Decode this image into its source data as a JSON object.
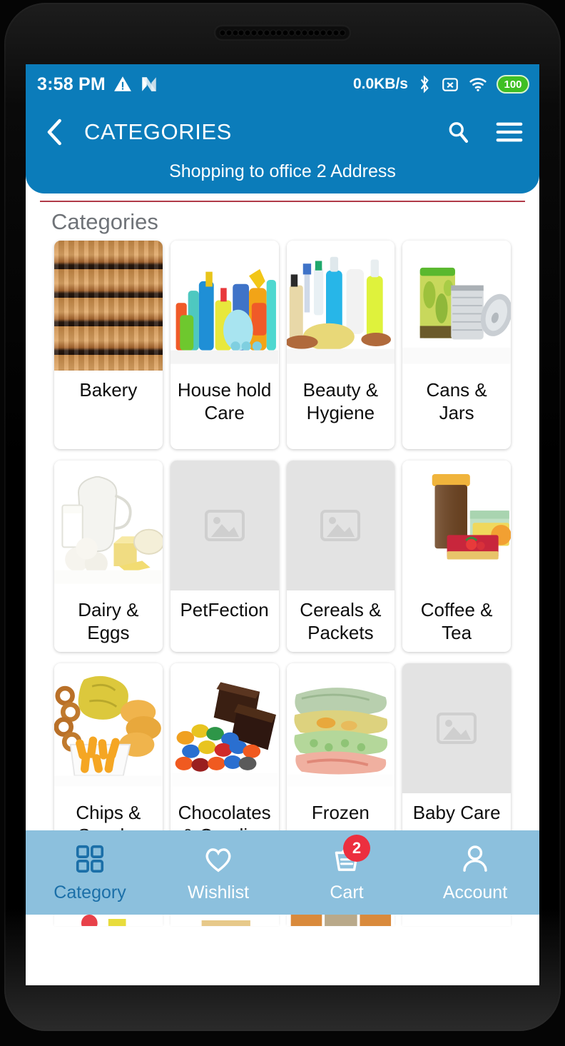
{
  "status_bar": {
    "time": "3:58 PM",
    "network_speed": "0.0KB/s",
    "battery_level": "100",
    "icons": [
      "warning-triangle-icon",
      "nfc-n-icon",
      "bluetooth-icon",
      "no-sim-icon",
      "wifi-icon",
      "battery-icon"
    ]
  },
  "app_bar": {
    "back_icon": "back-chevron-icon",
    "title": "CATEGORIES",
    "search_icon": "search-icon",
    "menu_icon": "hamburger-menu-icon",
    "subtitle": "Shopping to office 2 Address"
  },
  "colors": {
    "header_blue": "#0b7cba",
    "nav_blue": "#8cc0dd",
    "nav_active": "#1b6fa8",
    "divider_red": "#b03a48",
    "badge_red": "#ec2f3f",
    "battery_green": "#3fbf24",
    "placeholder_gray": "#e3e3e3"
  },
  "main": {
    "section_title": "Categories",
    "categories": [
      {
        "label": "Bakery",
        "art": "bakery",
        "has_image": true
      },
      {
        "label": "House hold Care",
        "art": "household",
        "has_image": true
      },
      {
        "label": "Beauty & Hygiene",
        "art": "beauty",
        "has_image": true
      },
      {
        "label": "Cans & Jars",
        "art": "cans",
        "has_image": true
      },
      {
        "label": "Dairy & Eggs",
        "art": "dairy",
        "has_image": true
      },
      {
        "label": "PetFection",
        "art": "none",
        "has_image": false
      },
      {
        "label": "Cereals & Packets",
        "art": "none",
        "has_image": false
      },
      {
        "label": "Coffee & Tea",
        "art": "coffee",
        "has_image": true
      },
      {
        "label": "Chips & Snacks",
        "art": "chips",
        "has_image": true
      },
      {
        "label": "Chocolates & Candies",
        "art": "choco",
        "has_image": true
      },
      {
        "label": "Frozen",
        "art": "frozen",
        "has_image": true
      },
      {
        "label": "Baby Care",
        "art": "none",
        "has_image": false
      }
    ]
  },
  "bottom_nav": {
    "items": [
      {
        "label": "Category",
        "icon": "grid-squares-icon",
        "active": true,
        "badge": ""
      },
      {
        "label": "Wishlist",
        "icon": "heart-icon",
        "active": false,
        "badge": ""
      },
      {
        "label": "Cart",
        "icon": "cart-basket-icon",
        "active": false,
        "badge": "2"
      },
      {
        "label": "Account",
        "icon": "person-icon",
        "active": false,
        "badge": ""
      }
    ]
  }
}
